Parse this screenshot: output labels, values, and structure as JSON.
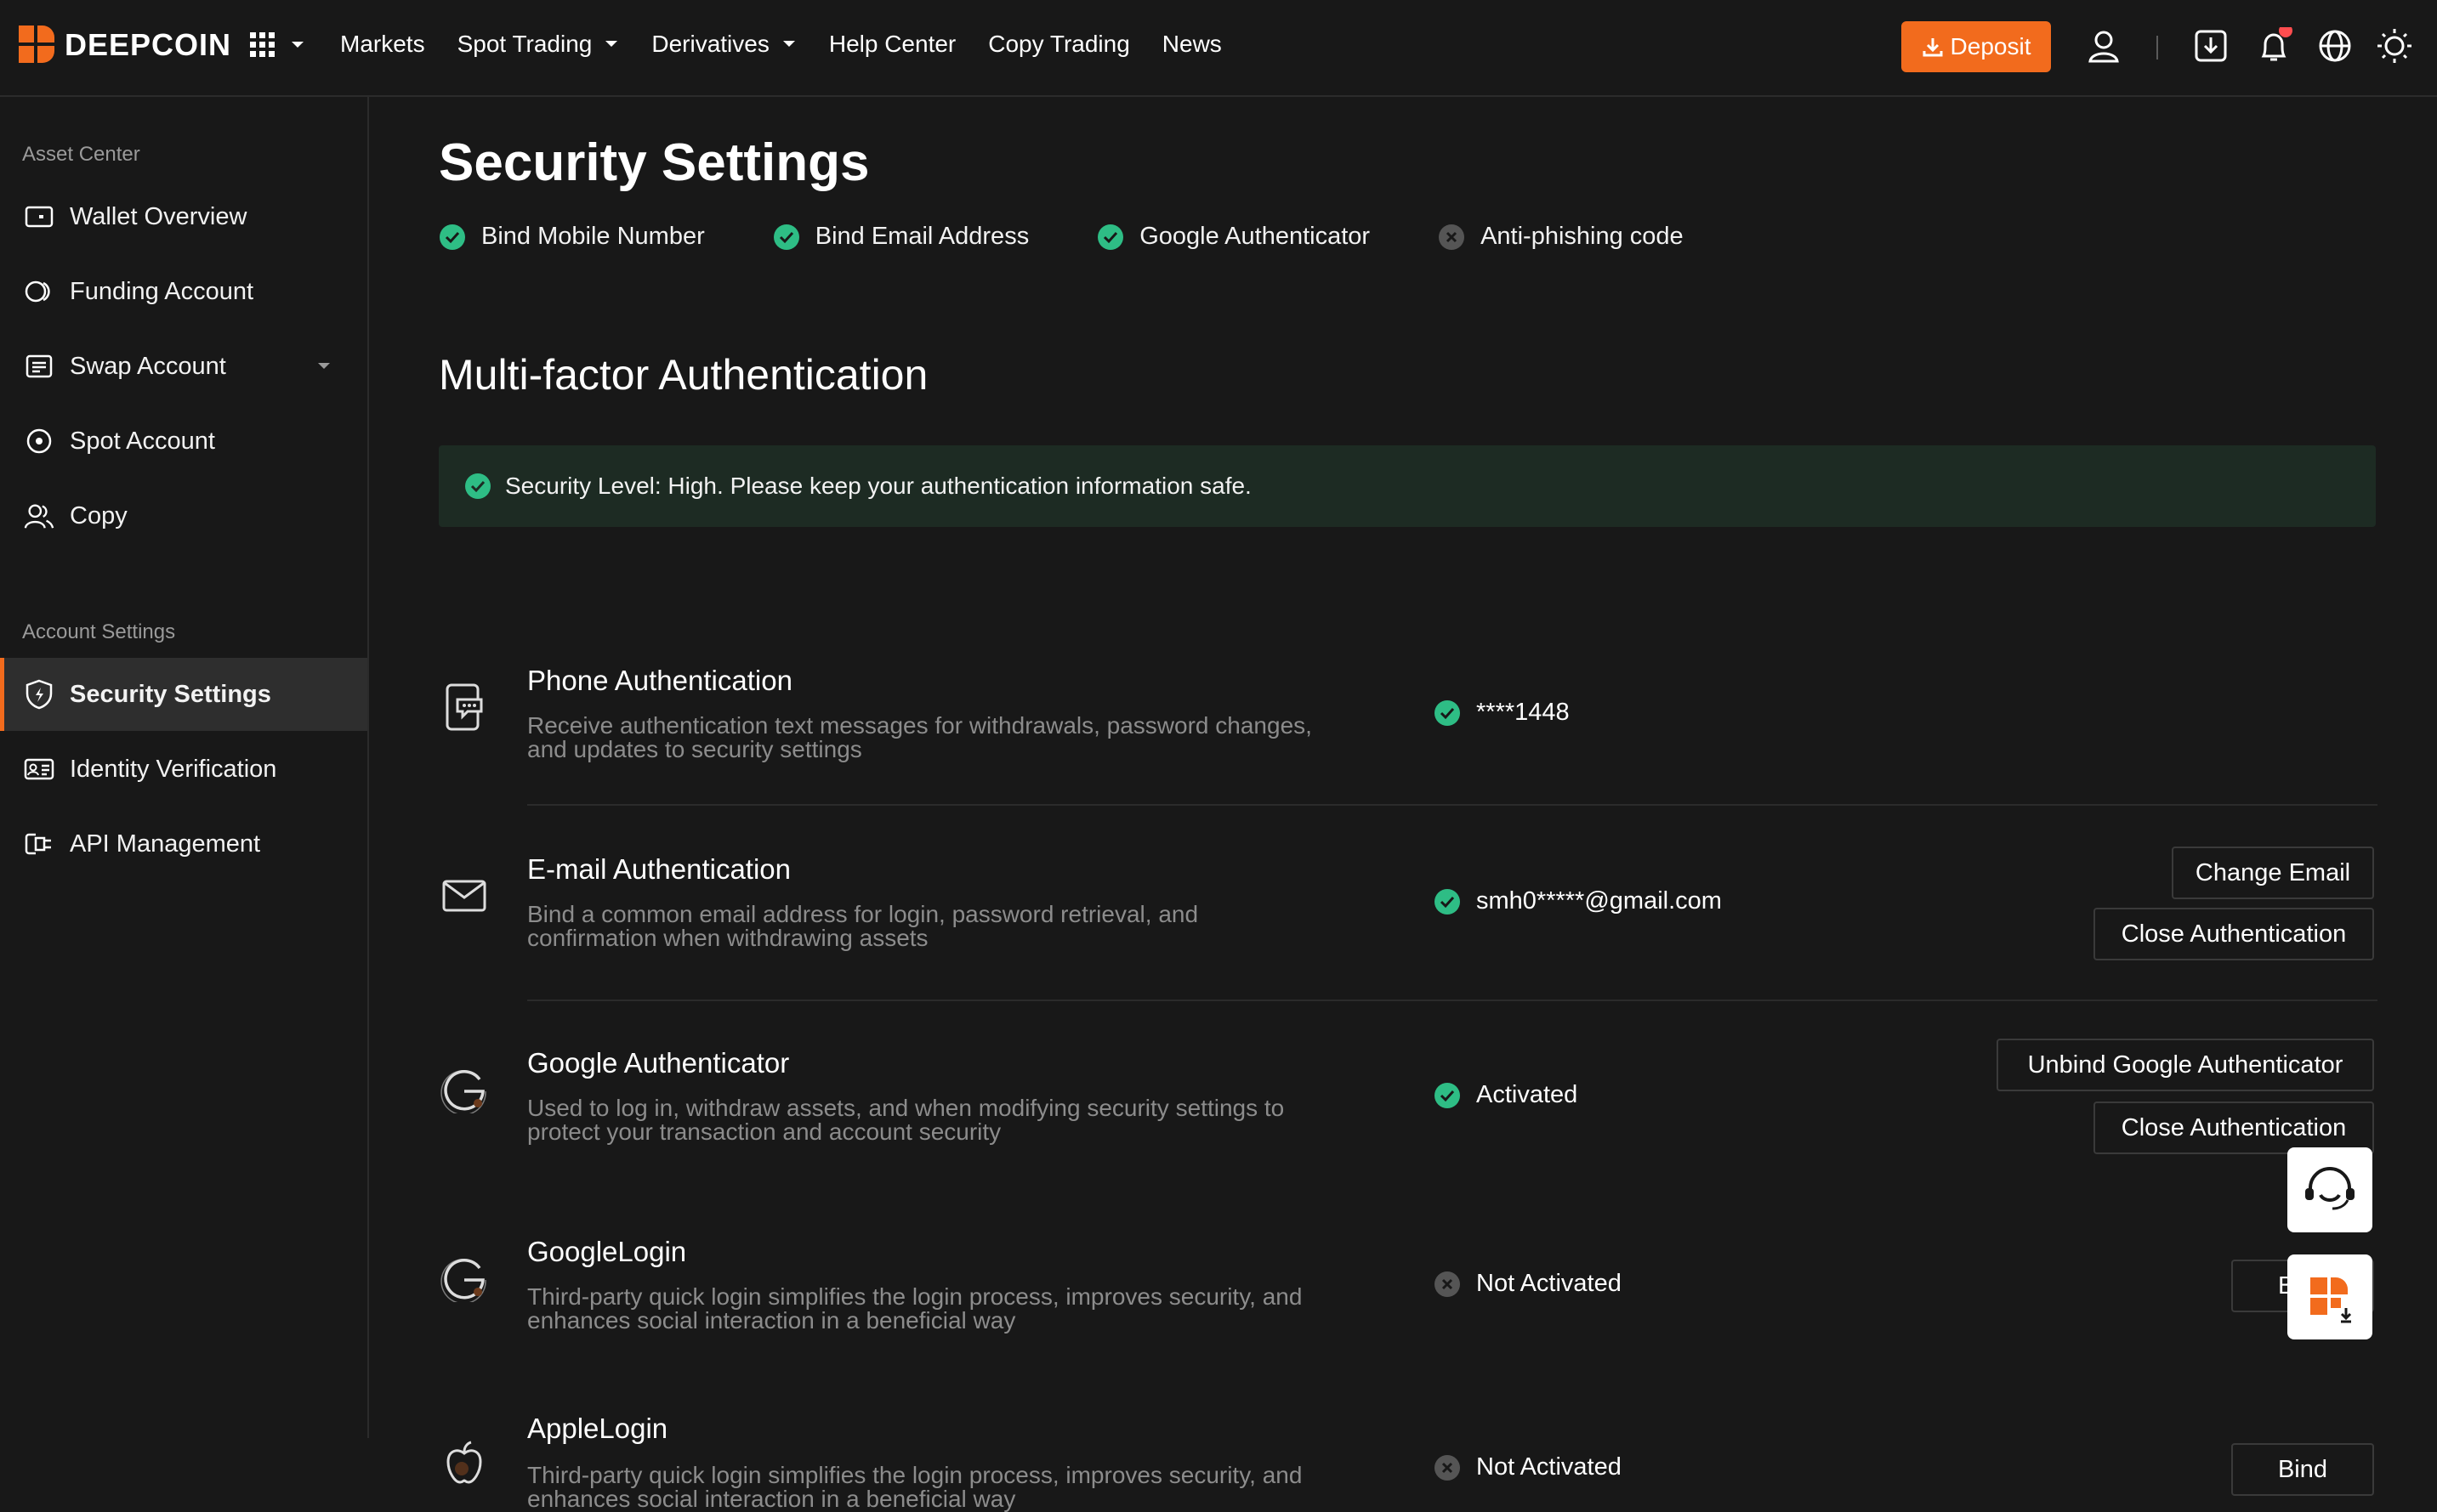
{
  "header": {
    "logo_text": "DEEPCOIN",
    "nav": [
      {
        "label": "Markets",
        "has_caret": false
      },
      {
        "label": "Spot Trading",
        "has_caret": true
      },
      {
        "label": "Derivatives",
        "has_caret": true
      },
      {
        "label": "Help Center",
        "has_caret": false
      },
      {
        "label": "Copy Trading",
        "has_caret": false
      },
      {
        "label": "News",
        "has_caret": false
      }
    ],
    "deposit_label": "Deposit",
    "icons": [
      "user-icon",
      "download-icon",
      "bell-icon",
      "globe-icon",
      "theme-icon"
    ],
    "notification_dot_color": "#ff4d4f",
    "accent_color": "#f26b1d"
  },
  "sidebar": {
    "asset_section": "Asset Center",
    "asset_items": [
      {
        "label": "Wallet Overview",
        "icon": "wallet-icon"
      },
      {
        "label": "Funding Account",
        "icon": "funding-icon"
      },
      {
        "label": "Swap Account",
        "icon": "swap-account-icon",
        "has_caret": true
      },
      {
        "label": "Spot Account",
        "icon": "spot-account-icon"
      },
      {
        "label": "Copy",
        "icon": "copy-users-icon"
      }
    ],
    "account_section": "Account Settings",
    "account_items": [
      {
        "label": "Security Settings",
        "icon": "shield-icon",
        "active": true
      },
      {
        "label": "Identity Verification",
        "icon": "id-card-icon"
      },
      {
        "label": "API Management",
        "icon": "api-icon"
      }
    ]
  },
  "main": {
    "title": "Security Settings",
    "steps": [
      {
        "label": "Bind Mobile Number",
        "done": true
      },
      {
        "label": "Bind Email Address",
        "done": true
      },
      {
        "label": "Google Authenticator",
        "done": true
      },
      {
        "label": "Anti-phishing code",
        "done": false
      }
    ],
    "mfa_title": "Multi-factor Authentication",
    "banner_text": "Security Level: High. Please keep your authentication information safe.",
    "success_color": "#2ebd85",
    "methods": [
      {
        "title": "Phone Authentication",
        "icon": "phone-sms-icon",
        "desc_1": "Receive authentication text messages for withdrawals, password changes,",
        "desc_2": "and updates to security settings",
        "status": "****1448",
        "active": true,
        "buttons": []
      },
      {
        "title": "E-mail Authentication",
        "icon": "email-icon",
        "desc_1": "Bind a common email address for login, password retrieval, and",
        "desc_2": "confirmation when withdrawing assets",
        "status": "smh0*****@gmail.com",
        "active": true,
        "buttons": [
          "Change Email",
          "Close Authentication"
        ]
      },
      {
        "title": "Google Authenticator",
        "icon": "google-icon",
        "desc_1": "Used to log in, withdraw assets, and when modifying security settings to",
        "desc_2": "protect your transaction and account security",
        "status": "Activated",
        "active": true,
        "buttons": [
          "Unbind Google Authenticator",
          "Close Authentication"
        ]
      },
      {
        "title": "GoogleLogin",
        "icon": "google-icon",
        "desc_1": "Third-party quick login simplifies the login process, improves security, and",
        "desc_2": "enhances social interaction in a beneficial way",
        "status": "Not Activated",
        "active": false,
        "buttons": [
          "Bind"
        ]
      },
      {
        "title": "AppleLogin",
        "icon": "apple-icon",
        "desc_1": "Third-party quick login simplifies the login process, improves security, and",
        "desc_2": "enhances social interaction in a beneficial way",
        "status": "Not Activated",
        "active": false,
        "buttons": [
          "Bind"
        ]
      }
    ]
  },
  "floating": [
    "support-chat-icon",
    "app-download-icon"
  ]
}
